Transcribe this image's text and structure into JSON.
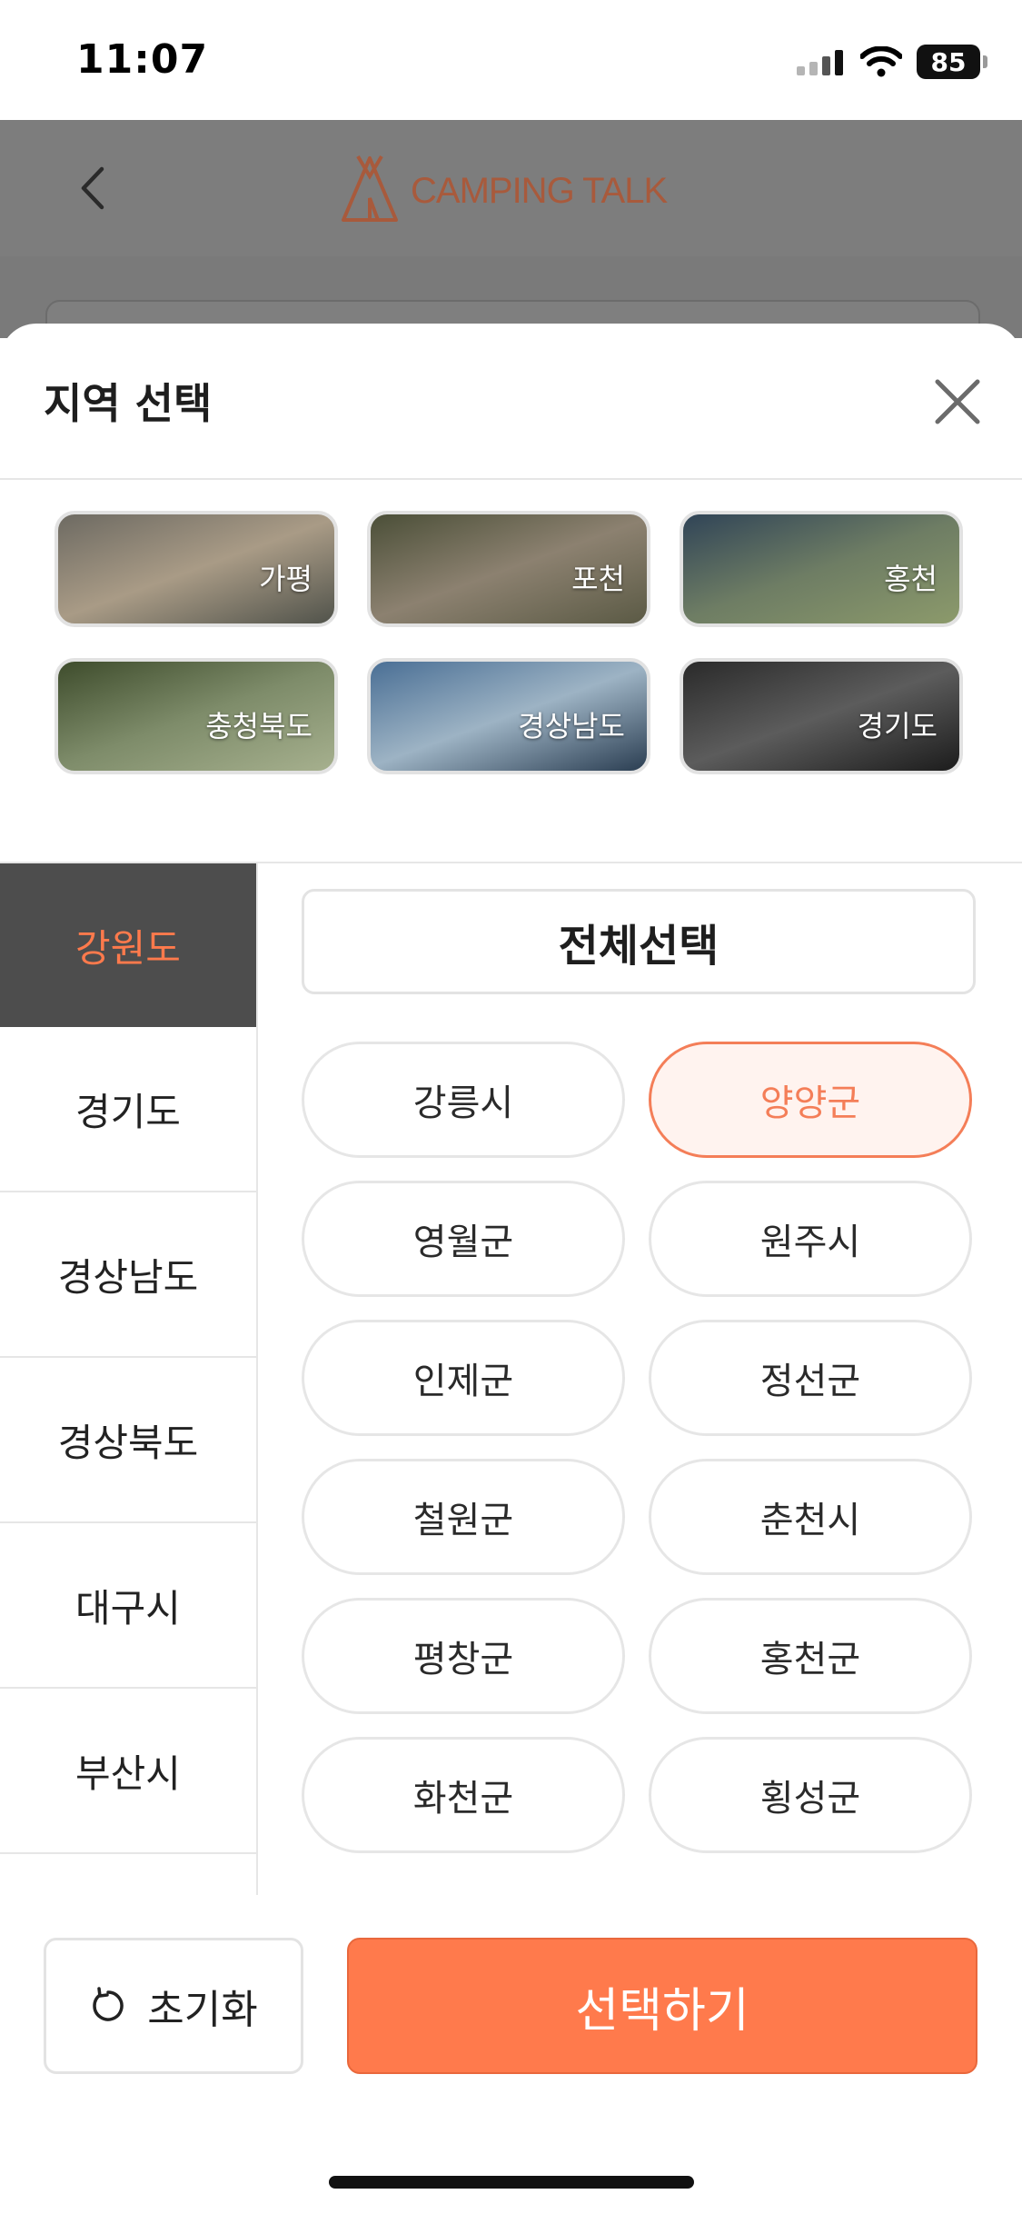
{
  "status_bar": {
    "time": "11:07",
    "battery": "85"
  },
  "app_header": {
    "logo_text": "CAMPING TALK"
  },
  "sheet": {
    "title": "지역 선택",
    "quick_regions": [
      {
        "label": "가평",
        "colors": [
          "#6d6a62",
          "#a99b86",
          "#51534b"
        ]
      },
      {
        "label": "포천",
        "colors": [
          "#4b4f38",
          "#8c8170",
          "#5b5a45"
        ]
      },
      {
        "label": "홍천",
        "colors": [
          "#304457",
          "#6e7d64",
          "#8c9a6b"
        ]
      },
      {
        "label": "충청북도",
        "colors": [
          "#3e4c2c",
          "#7e8c6a",
          "#a6b08e"
        ]
      },
      {
        "label": "경상남도",
        "colors": [
          "#4a6f95",
          "#9db3c4",
          "#2b3e52"
        ]
      },
      {
        "label": "경기도",
        "colors": [
          "#2a2a2a",
          "#5c5c5c",
          "#1c1c1c"
        ]
      }
    ],
    "provinces": [
      "강원도",
      "경기도",
      "경상남도",
      "경상북도",
      "대구시",
      "부산시"
    ],
    "active_province": "강원도",
    "select_all_label": "전체선택",
    "districts": [
      "강릉시",
      "양양군",
      "영월군",
      "원주시",
      "인제군",
      "정선군",
      "철원군",
      "춘천시",
      "평창군",
      "홍천군",
      "화천군",
      "횡성군"
    ],
    "selected_district": "양양군",
    "reset_label": "초기화",
    "submit_label": "선택하기"
  },
  "colors": {
    "accent": "#ff7a4c",
    "sidebar_active": "#4d4d4d"
  }
}
